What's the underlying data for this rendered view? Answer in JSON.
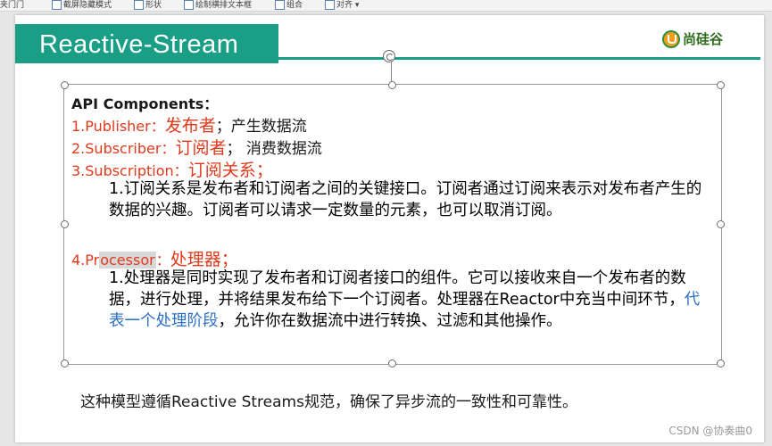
{
  "toolbar": {
    "items": [
      "夹门门",
      "截屏隐藏模式",
      "形状",
      "绘制横排文本框",
      "组合",
      "对齐"
    ]
  },
  "slide": {
    "title": "Reactive-Stream",
    "logo_text": "尚硅谷",
    "heading": "API Components：",
    "items": [
      {
        "num_label": "1.Publisher：",
        "highlight": "发布者",
        "rest": "；产生数据流"
      },
      {
        "num_label": "2.Subscriber：",
        "highlight": "订阅者",
        "rest": "； 消费数据流"
      },
      {
        "num_label": "3.Subscription：",
        "highlight": "订阅关系；",
        "rest": ""
      }
    ],
    "subscription_desc": "1.订阅关系是发布者和订阅者之间的关键接口。订阅者通过订阅来表示对发布者产生的数据的兴趣。订阅者可以请求一定数量的元素，也可以取消订阅。",
    "processor": {
      "label_start": "4.Pr",
      "label_hidden": "ocessor",
      "label_end": "：",
      "highlight": "处理器；"
    },
    "processor_desc_a": "1.处理器是同时实现了发布者和订阅者接口的组件。它可以接收来自一个发布者的数据，进行处理，并将结果发布给下一个订阅者。处理器在Reactor中充当中间环节，",
    "processor_desc_highlight": "代表一个处理阶段",
    "processor_desc_b": "，允许你在数据流中进行转换、过滤和其他操作。",
    "footer": "这种模型遵循Reactive Streams规范，确保了异步流的一致性和可靠性。"
  },
  "watermark": "CSDN @协奏曲0",
  "colors": {
    "teal": "#1a9e86",
    "red": "#e03a1c",
    "blue": "#2a6fc4"
  }
}
